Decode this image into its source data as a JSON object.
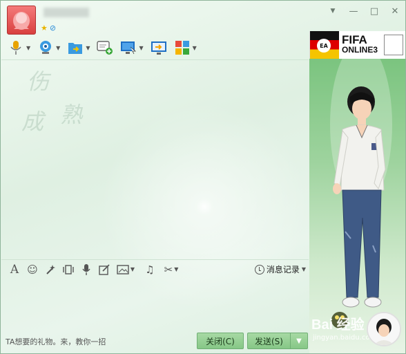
{
  "window": {
    "contact_name": "",
    "controls": {
      "collapse": "▼",
      "minimize": "—",
      "maximize": "□",
      "close": "✕"
    }
  },
  "toolbar": {
    "items": [
      {
        "name": "voice",
        "has_dropdown": true
      },
      {
        "name": "video",
        "has_dropdown": true
      },
      {
        "name": "file-transfer",
        "has_dropdown": true
      },
      {
        "name": "create-discussion",
        "has_dropdown": false
      },
      {
        "name": "remote-assist",
        "has_dropdown": true
      },
      {
        "name": "share-screen",
        "has_dropdown": false
      },
      {
        "name": "apps",
        "has_dropdown": true
      }
    ]
  },
  "ad": {
    "brand_small": "EA SPORTS",
    "line1": "FIFA",
    "line2": "ONLINE3",
    "ea": "EA"
  },
  "watermark": {
    "chars": [
      "伤",
      "成",
      "熟"
    ]
  },
  "input_toolbar": {
    "history_label": "消息记录"
  },
  "bottom": {
    "hint": "TA想要的礼物。来，教你一招",
    "close_label": "关闭(C)",
    "send_label": "发送(S)",
    "send_more": "▼"
  },
  "watermark_site": {
    "main": "Bai 经验",
    "sub": "jingyan.baidu.com"
  },
  "colors": {
    "accent_green": "#86c786",
    "panel_green": "#7bc47f",
    "avatar_red": "#d9403f"
  }
}
